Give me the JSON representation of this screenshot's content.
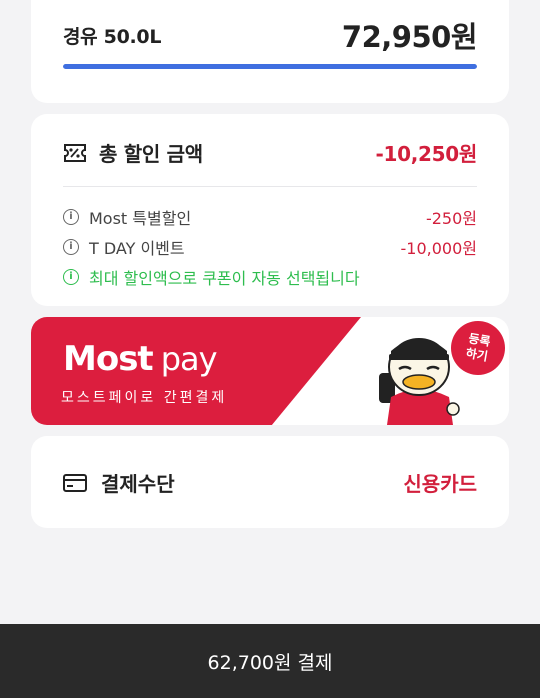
{
  "fuel": {
    "label": "경유 50.0L",
    "price": "72,950원",
    "progress_percent": 100,
    "progress_color": "#3f6fe0"
  },
  "discount": {
    "icon": "coupon-icon",
    "title": "총 할인 금액",
    "total": "-10,250원",
    "items": [
      {
        "icon": "info-icon",
        "label": "Most 특별할인",
        "amount": "-250원"
      },
      {
        "icon": "info-icon",
        "label": "T DAY 이벤트",
        "amount": "-10,000원"
      }
    ],
    "notice": {
      "icon": "info-icon",
      "text": "최대 할인액으로 쿠폰이 자동 선택됩니다"
    }
  },
  "banner": {
    "logo_main": "Most",
    "logo_pay": "pay",
    "subtitle": "모스트페이로 간편결제",
    "badge": "등록\n하기",
    "mascot": "duck-mascot-icon",
    "accent": "#dc1e3e"
  },
  "payment": {
    "icon": "credit-card-icon",
    "title": "결제수단",
    "value": "신용카드"
  },
  "checkout": {
    "label": "62,700원 결제"
  },
  "colors": {
    "accent_red": "#d21f3c",
    "notice_green": "#2ebd4e",
    "bottom_bar": "#2a2a2a"
  }
}
